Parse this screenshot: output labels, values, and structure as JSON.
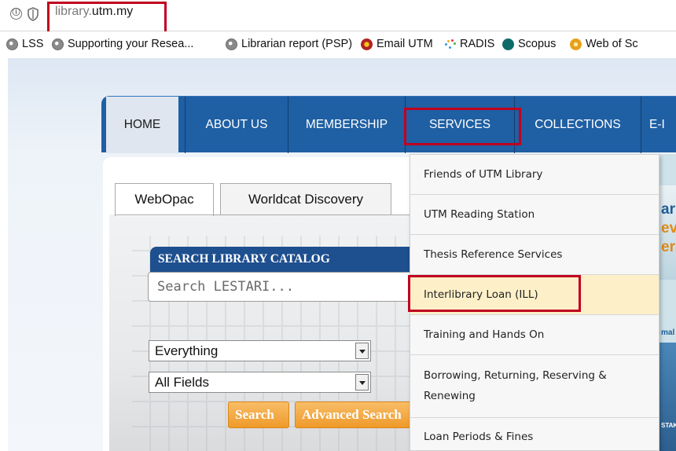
{
  "browser": {
    "url_prefix": "library.",
    "url_domain": "utm.my",
    "info_icon": "ⓘ",
    "bookmarks": [
      {
        "label": "LSS",
        "icon": "globe-icon"
      },
      {
        "label": "Supporting your Resea...",
        "icon": "globe-icon"
      },
      {
        "label": "Librarian report (PSP)",
        "icon": "globe-icon"
      },
      {
        "label": "Email UTM",
        "icon": "utm-logo-icon"
      },
      {
        "label": "RADIS",
        "icon": "radis-icon"
      },
      {
        "label": "Scopus",
        "icon": "scopus-icon"
      },
      {
        "label": "Web of Sc",
        "icon": "wos-icon"
      }
    ]
  },
  "nav": {
    "items": [
      "HOME",
      "ABOUT US",
      "MEMBERSHIP",
      "SERVICES",
      "COLLECTIONS",
      "E-I"
    ]
  },
  "search": {
    "tabs": [
      "WebOpac",
      "Worldcat Discovery"
    ],
    "title": "SEARCH LIBRARY CATALOG",
    "placeholder": "Search LESTARI...",
    "scope_selected": "Everything",
    "field_selected": "All Fields",
    "search_button": "Search",
    "advanced_button": "Advanced Search"
  },
  "services_menu": {
    "items": [
      "Friends of UTM Library",
      "UTM Reading Station",
      "Thesis Reference Services",
      "Interlibrary Loan (ILL)",
      "Training and Hands On",
      "Borrowing, Returning, Reserving & Renewing",
      "Loan Periods & Fines"
    ],
    "highlighted_index": 3
  },
  "banner": {
    "fragments": [
      "ar",
      "ev",
      "er"
    ],
    "small_fragments": [
      "mal",
      "STAK"
    ]
  },
  "colors": {
    "nav_blue": "#1f5fa3",
    "highlight_red": "#c0001f",
    "button_orange": "#ef9a2a",
    "menu_hover": "#fdf0c8"
  }
}
